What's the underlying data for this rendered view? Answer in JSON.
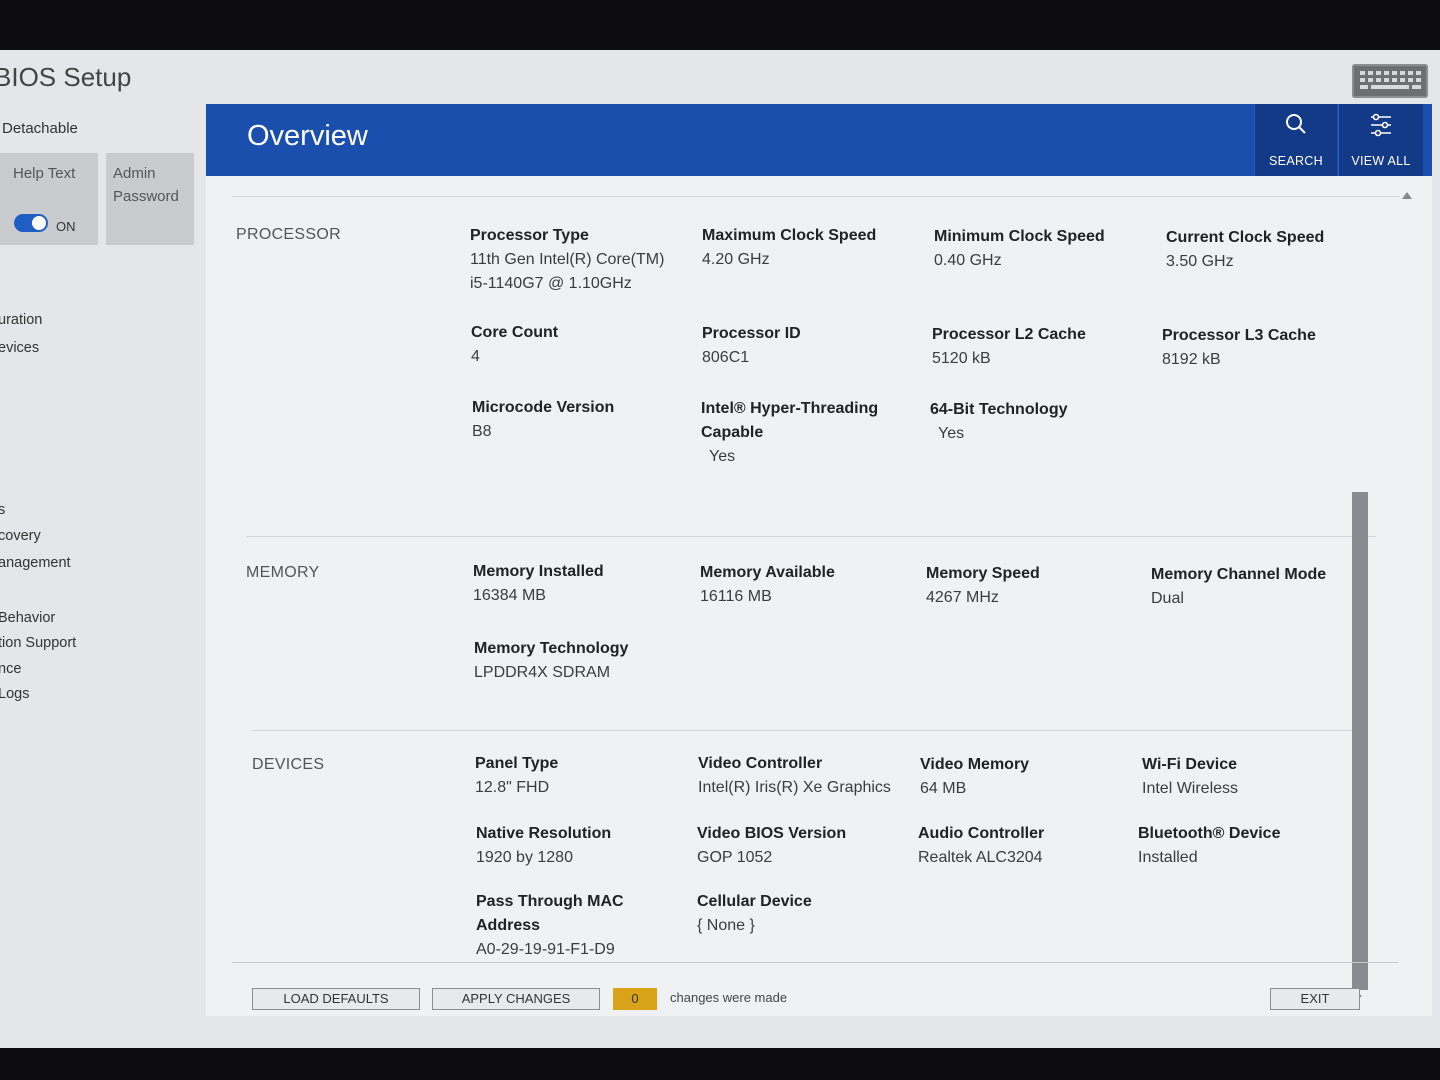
{
  "app": {
    "title": "BIOS Setup"
  },
  "sidebar": {
    "detachable": "Detachable",
    "help_text": {
      "label": "Help Text",
      "toggle_state": "ON"
    },
    "admin_password": "Admin Password",
    "items": [
      "uration",
      "evices",
      "s",
      "covery",
      "anagement",
      "Behavior",
      "tion Support",
      "nce",
      "Logs"
    ]
  },
  "header": {
    "title": "Overview",
    "search_label": "SEARCH",
    "view_all_label": "VIEW ALL"
  },
  "processor": {
    "title": "PROCESSOR",
    "processor_type": {
      "label": "Processor Type",
      "value_line1": "11th Gen Intel(R) Core(TM)",
      "value_line2": "i5-1140G7 @ 1.10GHz"
    },
    "max_clock": {
      "label": "Maximum Clock Speed",
      "value": "4.20 GHz"
    },
    "min_clock": {
      "label": "Minimum Clock Speed",
      "value": "0.40 GHz"
    },
    "current_clock": {
      "label": "Current Clock Speed",
      "value": "3.50 GHz"
    },
    "core_count": {
      "label": "Core Count",
      "value": "4"
    },
    "processor_id": {
      "label": "Processor ID",
      "value": "806C1"
    },
    "l2_cache": {
      "label": "Processor L2 Cache",
      "value": "5120 kB"
    },
    "l3_cache": {
      "label": "Processor L3 Cache",
      "value": "8192 kB"
    },
    "microcode": {
      "label": "Microcode Version",
      "value": "B8"
    },
    "hyperthreading": {
      "label_line1": "Intel® Hyper-Threading",
      "label_line2": "Capable",
      "value": "Yes"
    },
    "bit64": {
      "label": "64-Bit Technology",
      "value": "Yes"
    }
  },
  "memory": {
    "title": "MEMORY",
    "installed": {
      "label": "Memory Installed",
      "value": "16384 MB"
    },
    "available": {
      "label": "Memory Available",
      "value": "16116 MB"
    },
    "speed": {
      "label": "Memory Speed",
      "value": "4267 MHz"
    },
    "channel_mode": {
      "label": "Memory Channel Mode",
      "value": "Dual"
    },
    "technology": {
      "label": "Memory Technology",
      "value": "LPDDR4X SDRAM"
    }
  },
  "devices": {
    "title": "DEVICES",
    "panel_type": {
      "label": "Panel Type",
      "value": "12.8\" FHD"
    },
    "video_controller": {
      "label": "Video Controller",
      "value": "Intel(R) Iris(R) Xe Graphics"
    },
    "video_memory": {
      "label": "Video Memory",
      "value": "64 MB"
    },
    "wifi": {
      "label": "Wi-Fi Device",
      "value": "Intel Wireless"
    },
    "native_resolution": {
      "label": "Native Resolution",
      "value": "1920 by 1280"
    },
    "video_bios": {
      "label": "Video BIOS Version",
      "value": "GOP 1052"
    },
    "audio": {
      "label": "Audio Controller",
      "value": "Realtek ALC3204"
    },
    "bluetooth": {
      "label": "Bluetooth® Device",
      "value": "Installed"
    },
    "mac": {
      "label": "Pass Through MAC Address",
      "value": "A0-29-19-91-F1-D9"
    },
    "cellular": {
      "label": "Cellular Device",
      "value": "{ None }"
    }
  },
  "footer": {
    "load_defaults": "LOAD DEFAULTS",
    "apply_changes": "APPLY CHANGES",
    "change_count": "0",
    "changes_text": "changes were made",
    "exit": "EXIT"
  },
  "colors": {
    "header_blue": "#1b4fae",
    "header_button": "#123a86",
    "badge": "#d9a419",
    "toggle": "#1f5ec2"
  }
}
